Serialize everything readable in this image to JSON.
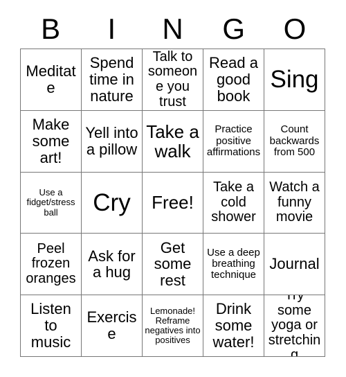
{
  "card": {
    "title_letters": [
      "B",
      "I",
      "N",
      "G",
      "O"
    ],
    "columns": 5,
    "rows": 5,
    "colors": {
      "background": "#ffffff",
      "text": "#000000",
      "grid_line": "#777777"
    },
    "cells": [
      {
        "text": "Meditate",
        "size": "l"
      },
      {
        "text": "Spend time in nature",
        "size": "l"
      },
      {
        "text": "Talk to someone you trust",
        "size": "m"
      },
      {
        "text": "Read a good book",
        "size": "l"
      },
      {
        "text": "Sing",
        "size": "xxl"
      },
      {
        "text": "Make some art!",
        "size": "l"
      },
      {
        "text": "Yell into a pillow",
        "size": "l"
      },
      {
        "text": "Take a walk",
        "size": "xl"
      },
      {
        "text": "Practice positive affirmations",
        "size": "s"
      },
      {
        "text": "Count backwards from 500",
        "size": "s"
      },
      {
        "text": "Use a fidget/stress ball",
        "size": "xs"
      },
      {
        "text": "Cry",
        "size": "xxl"
      },
      {
        "text": "Free!",
        "size": "xl"
      },
      {
        "text": "Take a cold shower",
        "size": "m"
      },
      {
        "text": "Watch a funny movie",
        "size": "m"
      },
      {
        "text": "Peel frozen oranges",
        "size": "m"
      },
      {
        "text": "Ask for a hug",
        "size": "l"
      },
      {
        "text": "Get some rest",
        "size": "l"
      },
      {
        "text": "Use a deep breathing technique",
        "size": "s"
      },
      {
        "text": "Journal",
        "size": "l"
      },
      {
        "text": "Listen to music",
        "size": "l"
      },
      {
        "text": "Exercise",
        "size": "l"
      },
      {
        "text": "Lemonade! Reframe negatives into positives",
        "size": "xs"
      },
      {
        "text": "Drink some water!",
        "size": "l"
      },
      {
        "text": "Try some yoga or stretching",
        "size": "m"
      }
    ]
  }
}
